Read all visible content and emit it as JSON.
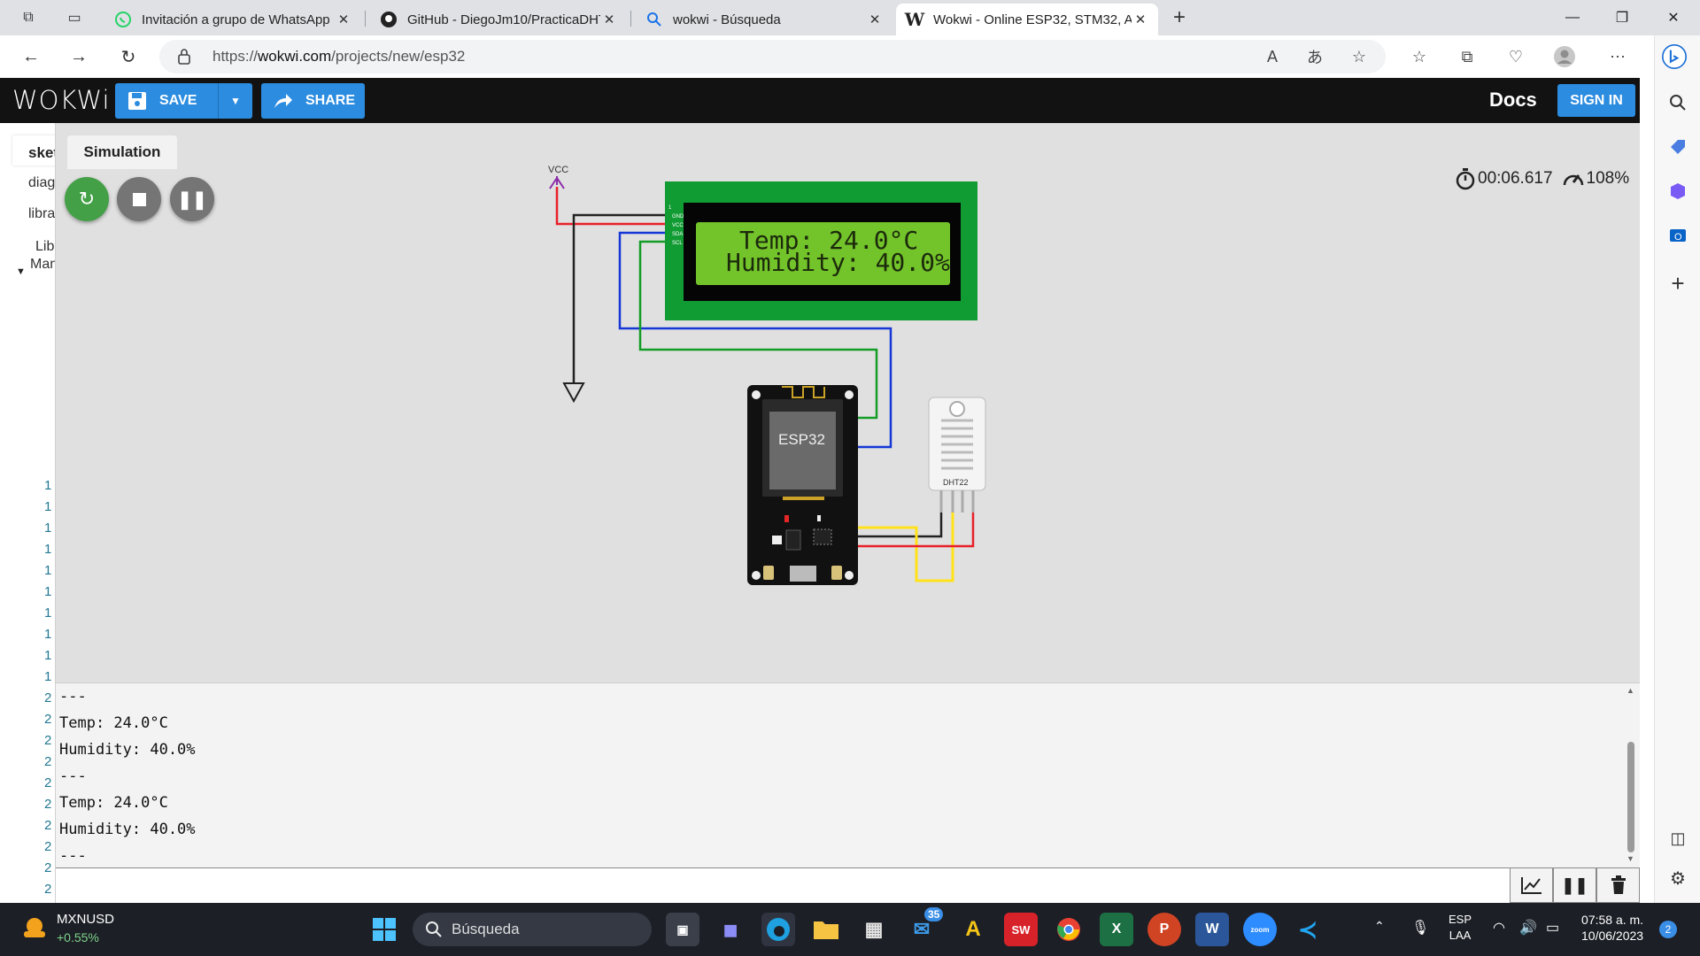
{
  "browser": {
    "tabs": [
      {
        "title": "Invitación a grupo de WhatsApp",
        "icon": "whatsapp-icon",
        "active": false
      },
      {
        "title": "GitHub - DiegoJm10/PracticaDHT",
        "icon": "github-icon",
        "active": false
      },
      {
        "title": "wokwi - Búsqueda",
        "icon": "search-icon",
        "active": false
      },
      {
        "title": "Wokwi - Online ESP32, STM32, A",
        "icon": "wokwi-icon",
        "active": true
      }
    ],
    "url": {
      "prefix": "https://",
      "domain": "wokwi.com",
      "path": "/projects/new/esp32"
    }
  },
  "header": {
    "logo": "WOKWi",
    "save_label": "SAVE",
    "share_label": "SHARE",
    "docs_label": "Docs",
    "signin_label": "SIGN IN",
    "accent": "#2c8ce0"
  },
  "editor": {
    "tab_label": "sket",
    "items": [
      "diag",
      "libra",
      "Lib",
      "Man"
    ],
    "line_numbers": [
      "1",
      "1",
      "1",
      "1",
      "1",
      "1",
      "1",
      "1",
      "1",
      "1",
      "2",
      "2",
      "2",
      "2",
      "2",
      "2",
      "2",
      "2",
      "2",
      "2"
    ]
  },
  "simulation": {
    "tab_label": "Simulation",
    "timer": "00:06.617",
    "speed": "108%",
    "lcd": {
      "line1": "Temp: 24.0°C",
      "line2": "Humidity: 40.0%"
    },
    "esp32_label": "ESP32",
    "dht_label": "DHT22",
    "vcc_label": "VCC",
    "lcd_pins": [
      "GND",
      "VCC",
      "SDA",
      "SCL"
    ]
  },
  "serial": {
    "lines": [
      "---",
      "Temp: 24.0°C",
      "Humidity: 40.0%",
      "---",
      "Temp: 24.0°C",
      "Humidity: 40.0%",
      "---"
    ]
  },
  "taskbar": {
    "ticker_symbol": "MXNUSD",
    "ticker_change": "+0.55%",
    "search_placeholder": "Búsqueda",
    "mail_badge": "35",
    "lang_top": "ESP",
    "lang_bottom": "LAA",
    "time": "07:58 a. m.",
    "date": "10/06/2023",
    "notif_count": "2"
  }
}
